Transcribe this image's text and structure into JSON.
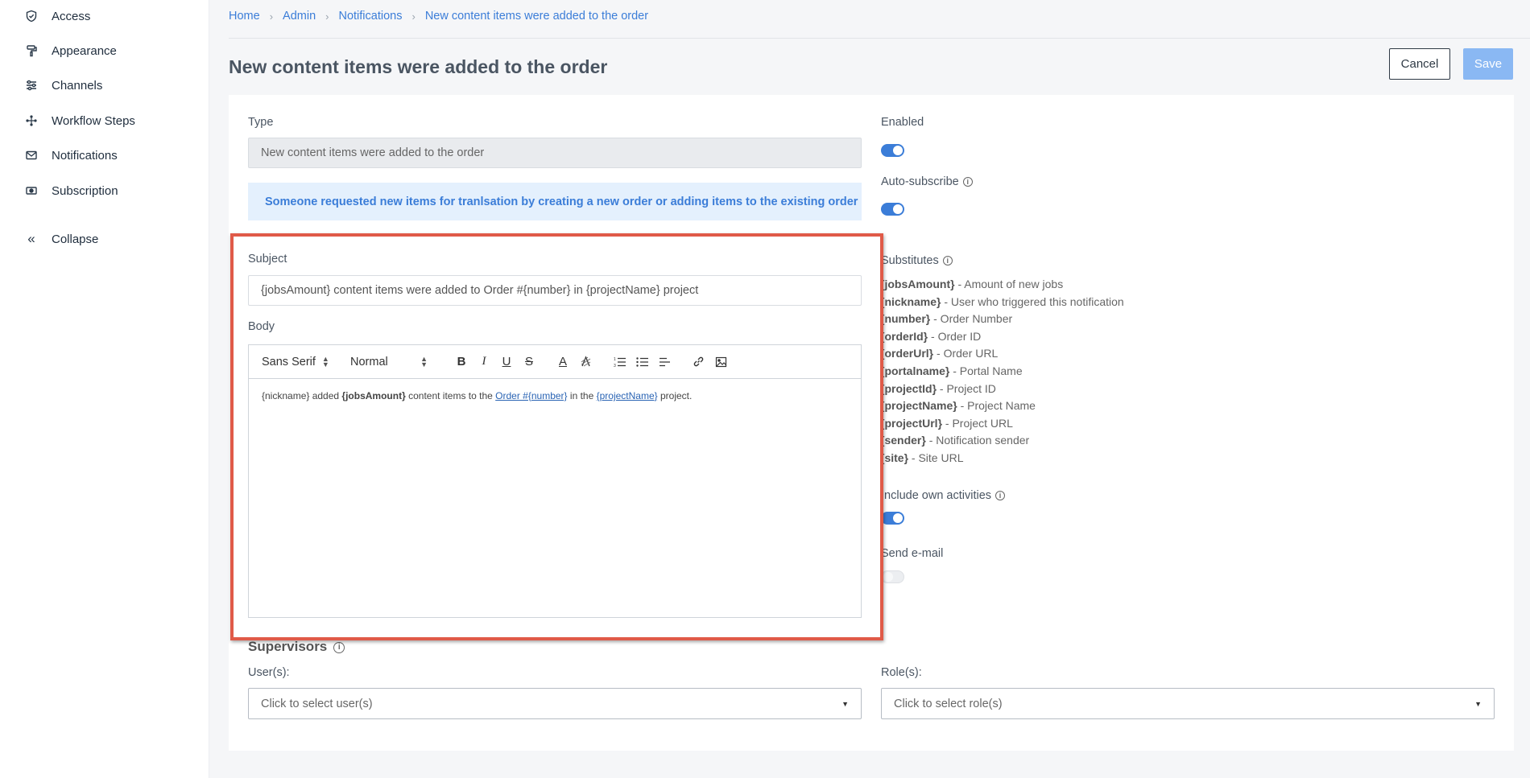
{
  "sidebar": {
    "items": [
      {
        "label": "Access",
        "icon": "shield-check-icon"
      },
      {
        "label": "Appearance",
        "icon": "paint-roller-icon"
      },
      {
        "label": "Channels",
        "icon": "sliders-icon"
      },
      {
        "label": "Workflow Steps",
        "icon": "workflow-icon"
      },
      {
        "label": "Notifications",
        "icon": "envelope-icon"
      },
      {
        "label": "Subscription",
        "icon": "money-icon"
      }
    ],
    "collapse_label": "Collapse"
  },
  "breadcrumb": [
    "Home",
    "Admin",
    "Notifications",
    "New content items were added to the order"
  ],
  "page_title": "New content items were added to the order",
  "actions": {
    "cancel": "Cancel",
    "save": "Save"
  },
  "form": {
    "type_label": "Type",
    "type_value": "New content items were added to the order",
    "info_text": "Someone requested new items for tranlsation by creating a new order or adding items to the existing order",
    "subject_label": "Subject",
    "subject_value": "{jobsAmount} content items were added to Order #{number} in {projectName} project",
    "body_label": "Body",
    "editor": {
      "font": "Sans Serif",
      "size": "Normal",
      "body": {
        "t1": "{nickname} added ",
        "b1": "{jobsAmount}",
        "t2": " content items to the ",
        "link1": "Order #{number}",
        "t3": " in the ",
        "link2": "{projectName}",
        "t4": " project."
      }
    }
  },
  "settings": {
    "enabled_label": "Enabled",
    "enabled": true,
    "auto_subscribe_label": "Auto-subscribe",
    "auto_subscribe": true,
    "substitutes_label": "Substitutes",
    "substitutes": [
      {
        "key": "{jobsAmount}",
        "desc": " - Amount of new jobs"
      },
      {
        "key": "{nickname}",
        "desc": " - User who triggered this notification"
      },
      {
        "key": "{number}",
        "desc": " - Order Number"
      },
      {
        "key": "{orderId}",
        "desc": " - Order ID"
      },
      {
        "key": "{orderUrl}",
        "desc": " - Order URL"
      },
      {
        "key": "{portalname}",
        "desc": " - Portal Name"
      },
      {
        "key": "{projectId}",
        "desc": " - Project ID"
      },
      {
        "key": "{projectName}",
        "desc": " - Project Name"
      },
      {
        "key": "{projectUrl}",
        "desc": " - Project URL"
      },
      {
        "key": "{sender}",
        "desc": " - Notification sender"
      },
      {
        "key": "{site}",
        "desc": " - Site URL"
      }
    ],
    "include_own_label": "Include own activities",
    "include_own": true,
    "send_email_label": "Send e-mail",
    "send_email": false
  },
  "supervisors": {
    "title": "Supervisors",
    "users_label": "User(s):",
    "users_placeholder": "Click to select user(s)",
    "roles_label": "Role(s):",
    "roles_placeholder": "Click to select role(s)"
  },
  "colors": {
    "accent": "#3b7dd8",
    "highlight": "#e05a48",
    "save_disabled": "#8ab8f3"
  }
}
